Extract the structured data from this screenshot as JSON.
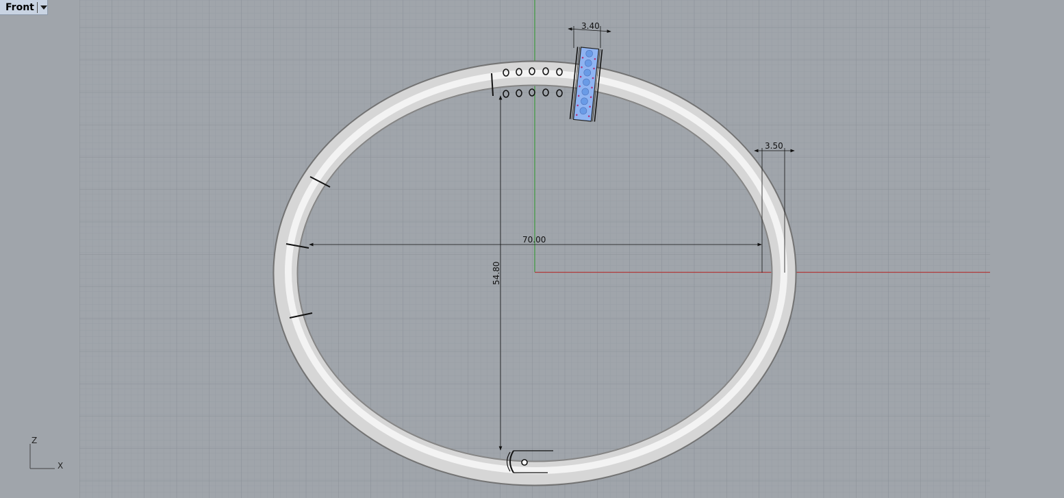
{
  "viewport": {
    "name": "Front",
    "menu_icon": "chevron-down-icon"
  },
  "dimensions": {
    "width": "70.00",
    "height": "54.80",
    "tube_thickness": "3.50",
    "band_width": "3.40"
  },
  "axes_gizmo": {
    "vertical": "Z",
    "horizontal": "X"
  },
  "colors": {
    "background": "#a0a5ab",
    "grid_minor": "#969ca3",
    "grid_major": "#8a9097",
    "x_axis": "#b03a3a",
    "y_axis": "#3e9a3e",
    "bangle": "#dedede",
    "band_blue": "#8fb4f2"
  }
}
